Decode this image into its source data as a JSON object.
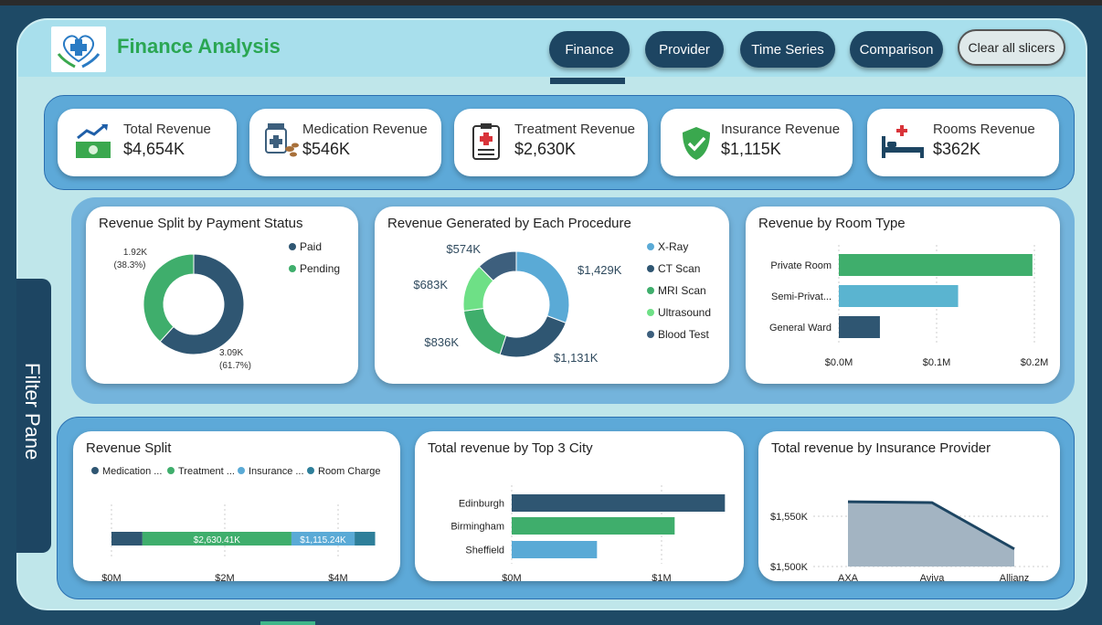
{
  "header": {
    "title": "Finance Analysis",
    "nav": [
      "Finance",
      "Provider",
      "Time Series",
      "Comparison"
    ],
    "clear_label": "Clear all slicers"
  },
  "kpis": [
    {
      "label": "Total Revenue",
      "value": "$4,654K",
      "icon": "money-chart-icon"
    },
    {
      "label": "Medication Revenue",
      "value": "$546K",
      "icon": "medicine-bottle-icon"
    },
    {
      "label": "Treatment Revenue",
      "value": "$2,630K",
      "icon": "clipboard-medical-icon"
    },
    {
      "label": "Insurance Revenue",
      "value": "$1,115K",
      "icon": "shield-check-icon"
    },
    {
      "label": "Rooms Revenue",
      "value": "$362K",
      "icon": "hospital-bed-icon"
    }
  ],
  "filter_pane": "Filter Pane",
  "colors": {
    "navy": "#2f5672",
    "green": "#3fae6c",
    "blue": "#5aaad6",
    "lightgreen": "#6ee086",
    "darkslate": "#3d5f7d"
  },
  "chart_data": [
    {
      "type": "pie",
      "title": "Revenue Split by Payment Status",
      "legend": [
        "Paid",
        "Pending"
      ],
      "values": [
        3.09,
        1.92
      ],
      "labels": [
        [
          "3.09K",
          "(61.7%)"
        ],
        [
          "1.92K",
          "(38.3%)"
        ]
      ]
    },
    {
      "type": "pie",
      "title": "Revenue Generated by Each Procedure",
      "legend": [
        "X-Ray",
        "CT Scan",
        "MRI Scan",
        "Ultrasound",
        "Blood Test"
      ],
      "values": [
        1429,
        1131,
        836,
        683,
        574
      ],
      "labels": [
        "$1,429K",
        "$1,131K",
        "$836K",
        "$683K",
        "$574K"
      ]
    },
    {
      "type": "bar",
      "title": "Revenue by Room Type",
      "categories": [
        "Private Room",
        "Semi-Privat...",
        "General Ward"
      ],
      "values": [
        0.198,
        0.122,
        0.042
      ],
      "ticks": [
        "$0.0M",
        "$0.1M",
        "$0.2M"
      ],
      "xlim": [
        0,
        0.2
      ]
    },
    {
      "type": "bar",
      "title": "Revenue Split",
      "legend": [
        "Medication ...",
        "Treatment ...",
        "Insurance ...",
        "Room Charge"
      ],
      "values": [
        546,
        2630.41,
        1115.24,
        362
      ],
      "labels": [
        "",
        "$2,630.41K",
        "$1,115.24K",
        ""
      ],
      "ticks": [
        "$0M",
        "$2M",
        "$4M"
      ],
      "xlim": [
        0,
        4.8
      ]
    },
    {
      "type": "bar",
      "title": "Total revenue by Top 3 City",
      "categories": [
        "Edinburgh",
        "Birmingham",
        "Sheffield"
      ],
      "values": [
        1.4,
        1.07,
        0.56
      ],
      "ticks": [
        "$0M",
        "$1M"
      ],
      "xlim": [
        0,
        1.5
      ]
    },
    {
      "type": "area",
      "title": "Total revenue by Insurance Provider",
      "categories": [
        "AXA",
        "Aviva",
        "Allianz"
      ],
      "values": [
        1570,
        1569,
        1519
      ],
      "ticks": [
        "$1,550K",
        "$1,500K"
      ],
      "ylim": [
        1500,
        1575
      ]
    }
  ]
}
